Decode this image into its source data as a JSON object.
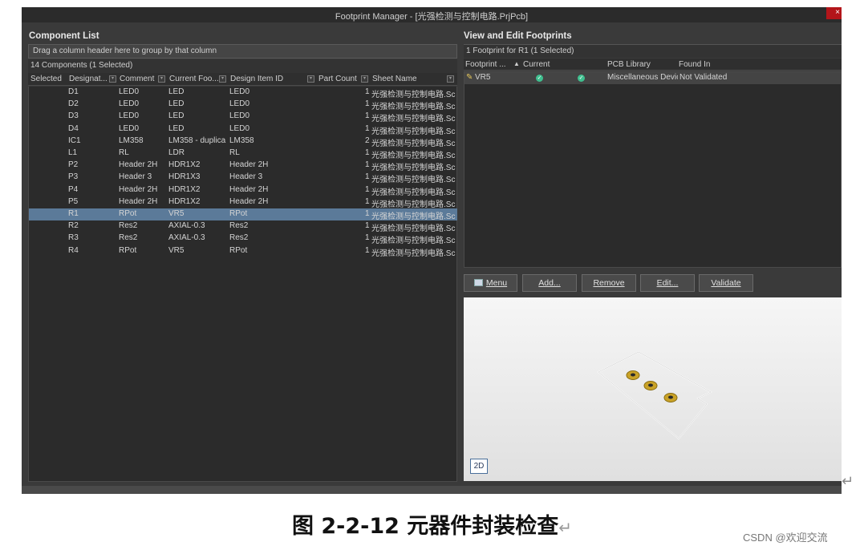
{
  "window": {
    "title": "Footprint Manager - [光强检测与控制电路.PrjPcb]",
    "close_label": "×"
  },
  "component_list": {
    "title": "Component List",
    "group_hint": "Drag a column header here to group by that column",
    "count_text": "14 Components (1 Selected)",
    "columns": [
      "Selected",
      "Designat...",
      "Comment",
      "Current Foo...",
      "Design Item ID",
      "Part Count",
      "Sheet Name"
    ],
    "rows": [
      {
        "designator": "D1",
        "comment": "LED0",
        "footprint": "LED",
        "design_item_id": "LED0",
        "part_count": "1",
        "sheet": "光强检测与控制电路.Sc",
        "selected": false
      },
      {
        "designator": "D2",
        "comment": "LED0",
        "footprint": "LED",
        "design_item_id": "LED0",
        "part_count": "1",
        "sheet": "光强检测与控制电路.Sc",
        "selected": false
      },
      {
        "designator": "D3",
        "comment": "LED0",
        "footprint": "LED",
        "design_item_id": "LED0",
        "part_count": "1",
        "sheet": "光强检测与控制电路.Sc",
        "selected": false
      },
      {
        "designator": "D4",
        "comment": "LED0",
        "footprint": "LED",
        "design_item_id": "LED0",
        "part_count": "1",
        "sheet": "光强检测与控制电路.Sc",
        "selected": false
      },
      {
        "designator": "IC1",
        "comment": "LM358",
        "footprint": "LM358 - duplica",
        "design_item_id": "LM358",
        "part_count": "2",
        "sheet": "光强检测与控制电路.Sc",
        "selected": false
      },
      {
        "designator": "L1",
        "comment": "RL",
        "footprint": "LDR",
        "design_item_id": "RL",
        "part_count": "1",
        "sheet": "光强检测与控制电路.Sc",
        "selected": false
      },
      {
        "designator": "P2",
        "comment": "Header 2H",
        "footprint": "HDR1X2",
        "design_item_id": "Header 2H",
        "part_count": "1",
        "sheet": "光强检测与控制电路.Sc",
        "selected": false
      },
      {
        "designator": "P3",
        "comment": "Header 3",
        "footprint": "HDR1X3",
        "design_item_id": "Header 3",
        "part_count": "1",
        "sheet": "光强检测与控制电路.Sc",
        "selected": false
      },
      {
        "designator": "P4",
        "comment": "Header 2H",
        "footprint": "HDR1X2",
        "design_item_id": "Header 2H",
        "part_count": "1",
        "sheet": "光强检测与控制电路.Sc",
        "selected": false
      },
      {
        "designator": "P5",
        "comment": "Header 2H",
        "footprint": "HDR1X2",
        "design_item_id": "Header 2H",
        "part_count": "1",
        "sheet": "光强检测与控制电路.Sc",
        "selected": false
      },
      {
        "designator": "R1",
        "comment": "RPot",
        "footprint": "VR5",
        "design_item_id": "RPot",
        "part_count": "1",
        "sheet": "光强检测与控制电路.Sc",
        "selected": true
      },
      {
        "designator": "R2",
        "comment": "Res2",
        "footprint": "AXIAL-0.3",
        "design_item_id": "Res2",
        "part_count": "1",
        "sheet": "光强检测与控制电路.Sc",
        "selected": false
      },
      {
        "designator": "R3",
        "comment": "Res2",
        "footprint": "AXIAL-0.3",
        "design_item_id": "Res2",
        "part_count": "1",
        "sheet": "光强检测与控制电路.Sc",
        "selected": false
      },
      {
        "designator": "R4",
        "comment": "RPot",
        "footprint": "VR5",
        "design_item_id": "RPot",
        "part_count": "1",
        "sheet": "光强检测与控制电路.Sc",
        "selected": false
      }
    ]
  },
  "footprints": {
    "title": "View and Edit Footprints",
    "count_text": "1 Footprint for R1 (1 Selected)",
    "columns": [
      "Footprint ...",
      "Current",
      "PCB Library",
      "Found In"
    ],
    "rows": [
      {
        "footprint": "VR5",
        "pcb_library": "Miscellaneous Devic",
        "found_in": "Not Validated"
      }
    ],
    "buttons": {
      "menu": "Menu",
      "add": "Add...",
      "remove": "Remove",
      "edit": "Edit...",
      "validate": "Validate"
    },
    "view_mode": "2D"
  },
  "caption": "图 2-2-12   元器件封装检查",
  "watermark": "CSDN @欢迎交流",
  "colors": {
    "selection": "#5b7a99",
    "check": "#3fbf8f",
    "pad": "#c9a227",
    "close": "#b3151a"
  }
}
